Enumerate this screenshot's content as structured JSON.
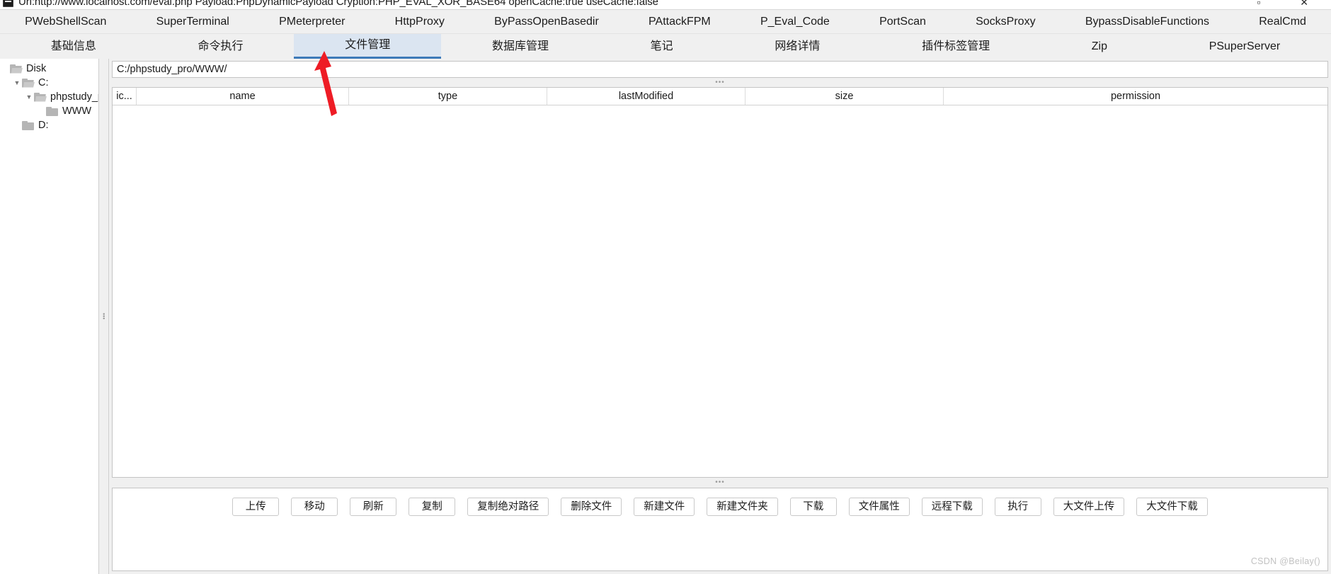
{
  "titlebar": {
    "text": "Url:http://www.localhost.com/eval.php Payload:PhpDynamicPayload Cryption:PHP_EVAL_XOR_BASE64 openCache:true useCache:false",
    "icon": "app-icon",
    "controls": "▫ ✕"
  },
  "plugin_tabs": [
    {
      "label": "PWebShellScan"
    },
    {
      "label": "SuperTerminal"
    },
    {
      "label": "PMeterpreter"
    },
    {
      "label": "HttpProxy"
    },
    {
      "label": "ByPassOpenBasedir"
    },
    {
      "label": "PAttackFPM"
    },
    {
      "label": "P_Eval_Code"
    },
    {
      "label": "PortScan"
    },
    {
      "label": "SocksProxy"
    },
    {
      "label": "BypassDisableFunctions"
    },
    {
      "label": "RealCmd"
    }
  ],
  "func_tabs": [
    {
      "label": "基础信息",
      "active": false
    },
    {
      "label": "命令执行",
      "active": false
    },
    {
      "label": "文件管理",
      "active": true
    },
    {
      "label": "数据库管理",
      "active": false
    },
    {
      "label": "笔记",
      "active": false
    },
    {
      "label": "网络详情",
      "active": false
    },
    {
      "label": "插件标签管理",
      "active": false
    },
    {
      "label": "Zip",
      "active": false
    },
    {
      "label": "PSuperServer",
      "active": false
    }
  ],
  "tree": {
    "nodes": [
      {
        "label": "Disk",
        "depth": 0,
        "twisty": "",
        "open": true
      },
      {
        "label": "C:",
        "depth": 1,
        "twisty": "▼",
        "open": true
      },
      {
        "label": "phpstudy_pro",
        "depth": 2,
        "twisty": "▼",
        "open": true
      },
      {
        "label": "WWW",
        "depth": 3,
        "twisty": "",
        "open": false
      },
      {
        "label": "D:",
        "depth": 1,
        "twisty": "",
        "open": false
      }
    ]
  },
  "path": {
    "value": "C:/phpstudy_pro/WWW/",
    "placeholder": "C:/"
  },
  "file_table": {
    "columns": [
      "ic...",
      "name",
      "type",
      "lastModified",
      "size",
      "permission"
    ],
    "rows": []
  },
  "buttons": [
    {
      "label": "上传"
    },
    {
      "label": "移动"
    },
    {
      "label": "刷新"
    },
    {
      "label": "复制"
    },
    {
      "label": "复制绝对路径"
    },
    {
      "label": "删除文件"
    },
    {
      "label": "新建文件"
    },
    {
      "label": "新建文件夹"
    },
    {
      "label": "下载"
    },
    {
      "label": "文件属性"
    },
    {
      "label": "远程下载"
    },
    {
      "label": "执行"
    },
    {
      "label": "大文件上传"
    },
    {
      "label": "大文件下载"
    }
  ],
  "splitters": {
    "dots": "•••"
  },
  "watermark": "CSDN @Beilay()",
  "colors": {
    "accent": "#3d7ab8",
    "active_tab_bg": "#dbe5f1",
    "panel_bg": "#f0f0f0",
    "annotation": "#ee1c25"
  }
}
